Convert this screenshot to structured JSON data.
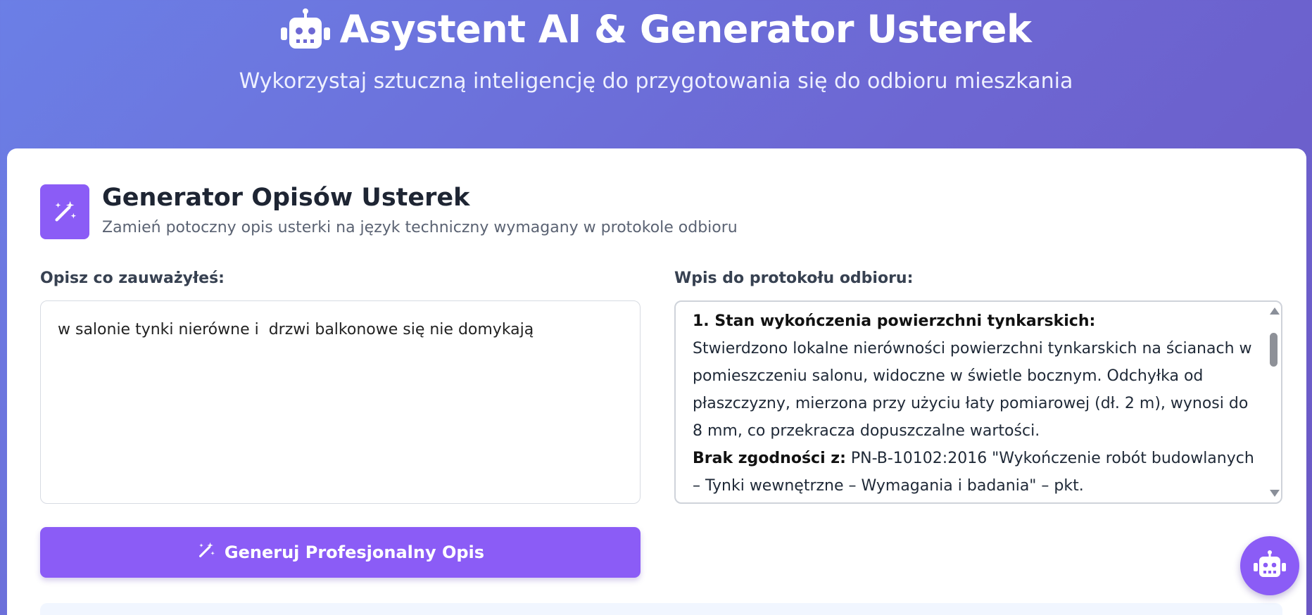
{
  "hero": {
    "title": "Asystent AI & Generator Usterek",
    "subtitle": "Wykorzystaj sztuczną inteligencję do przygotowania się do odbioru mieszkania",
    "icon": "robot-icon"
  },
  "generator": {
    "icon": "magic-wand-icon",
    "title": "Generator Opisów Usterek",
    "subtitle": "Zamień potoczny opis usterki na język techniczny wymagany w protokole odbioru",
    "input_label": "Opisz co zauważyłeś:",
    "input_value": "w salonie tynki nierówne i  drzwi balkonowe się nie domykają",
    "output_label": "Wpis do protokołu odbioru:",
    "output": {
      "heading": "1. Stan wykończenia powierzchni tynkarskich:",
      "body": "Stwierdzono lokalne nierówności powierzchni tynkarskich na ścianach w pomieszczeniu salonu, widoczne w świetle bocznym. Odchyłka od płaszczyzny, mierzona przy użyciu łaty pomiarowej (dł. 2 m), wynosi do 8 mm, co przekracza dopuszczalne wartości.",
      "nonconformity_label": "Brak zgodności z:",
      "nonconformity_text": "PN-B-10102:2016 \"Wykończenie robót budowlanych – Tynki wewnętrzne – Wymagania i badania\" – pkt."
    },
    "button_label": "Generuj Profesjonalny Opis",
    "button_icon": "magic-wand-icon"
  },
  "chat": {
    "icon": "robot-icon"
  },
  "colors": {
    "accent": "#8b5cf6",
    "gradient_start": "#6b7fe6",
    "gradient_end": "#6b58c4"
  }
}
